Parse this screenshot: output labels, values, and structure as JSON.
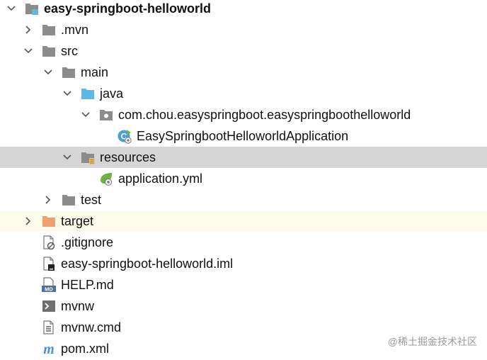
{
  "colors": {
    "folder_gray": "#8c8c8c",
    "source_blue": "#5db8e8",
    "excluded_orange": "#f0a06a",
    "selected_bg": "#d5d5d5",
    "highlight_bg": "#fdfbeb",
    "spring_green": "#6db33f",
    "class_blue": "#4b9fd5",
    "maven_blue": "#4a8fd8"
  },
  "tree": {
    "root": {
      "label": "easy-springboot-helloworld",
      "icon": "module-folder-icon"
    },
    "mvn": {
      "label": ".mvn",
      "icon": "folder-icon"
    },
    "src": {
      "label": "src",
      "icon": "folder-icon"
    },
    "main": {
      "label": "main",
      "icon": "folder-icon"
    },
    "java": {
      "label": "java",
      "icon": "source-folder-icon"
    },
    "package": {
      "label": "com.chou.easyspringboot.easyspringboothelloworld",
      "icon": "package-icon"
    },
    "app_class": {
      "label": "EasySpringbootHelloworldApplication",
      "icon": "spring-boot-class-icon"
    },
    "resources": {
      "label": "resources",
      "icon": "resources-folder-icon"
    },
    "app_yml": {
      "label": "application.yml",
      "icon": "spring-yml-icon"
    },
    "test": {
      "label": "test",
      "icon": "folder-icon"
    },
    "target": {
      "label": "target",
      "icon": "excluded-folder-icon"
    },
    "gitignore": {
      "label": ".gitignore",
      "icon": "ignored-file-icon"
    },
    "iml": {
      "label": "easy-springboot-helloworld.iml",
      "icon": "iml-file-icon"
    },
    "help": {
      "label": "HELP.md",
      "icon": "markdown-file-icon"
    },
    "mvnw": {
      "label": "mvnw",
      "icon": "shell-script-icon"
    },
    "mvnw_cmd": {
      "label": "mvnw.cmd",
      "icon": "text-file-icon"
    },
    "pom": {
      "label": "pom.xml",
      "icon": "maven-icon"
    }
  },
  "watermark": "@稀土掘金技术社区"
}
